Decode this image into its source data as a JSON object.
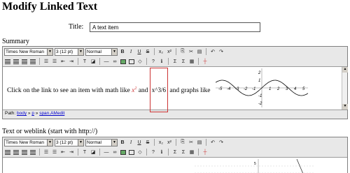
{
  "page": {
    "title": "Modify Linked Text"
  },
  "title_field": {
    "label": "Title:",
    "value": "A text item"
  },
  "summary": {
    "label": "Summary",
    "font": "Times New Roman",
    "size": "3 (12 pt)",
    "style": "Normal",
    "content": {
      "before": "Click on the link to see an item with math like ",
      "math_var": "x",
      "math_exp": "2",
      "and1": " and ",
      "math_box": "x^3/6",
      "after": " and graphs like "
    },
    "path": {
      "prefix": "Path: ",
      "items": [
        "body",
        "p",
        "span.AMedit"
      ]
    }
  },
  "weblink": {
    "label": "Text or weblink (start with http://)",
    "font": "Times New Roman",
    "size": "3 (12 pt)",
    "style": "Normal"
  },
  "graph": {
    "x_ticks": [
      "-5",
      "-4",
      "-3",
      "-2",
      "-1",
      "1",
      "2",
      "3",
      "4",
      "5"
    ],
    "y_ticks": [
      "2",
      "1",
      "-1",
      "-2"
    ]
  },
  "graph2": {
    "y_tick": "5"
  }
}
